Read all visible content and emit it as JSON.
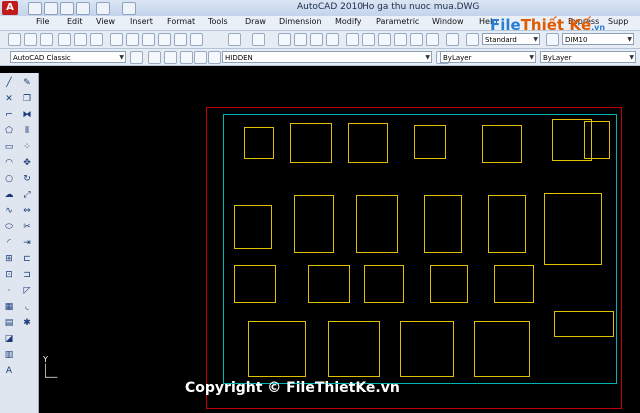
{
  "titlebar": {
    "app_name": "AutoCAD 2010",
    "document": "Ho ga thu nuoc mua.DWG",
    "watermark_logo": {
      "part1": "File",
      "part2": "Thiết Kế",
      "part3": ".vn"
    }
  },
  "menu": [
    "File",
    "Edit",
    "View",
    "Insert",
    "Format",
    "Tools",
    "Draw",
    "Dimension",
    "Modify",
    "Parametric",
    "Window",
    "Help",
    "Express",
    "Supp"
  ],
  "toolbar": {
    "text_style": "Standard",
    "dim_style": "DIM10"
  },
  "workspace": {
    "selected": "AutoCAD Classic"
  },
  "layers": {
    "current_layer": "HIDDEN",
    "color": "ByLayer",
    "linetype": "ByLayer"
  },
  "canvas": {
    "watermark": "Copyright © FileThietKe.vn",
    "ucs_label": "Y"
  },
  "colors": {
    "sheet_border": "#c00000",
    "frame": "#00b4b4",
    "detail": "#e0c000",
    "background": "#000000"
  }
}
